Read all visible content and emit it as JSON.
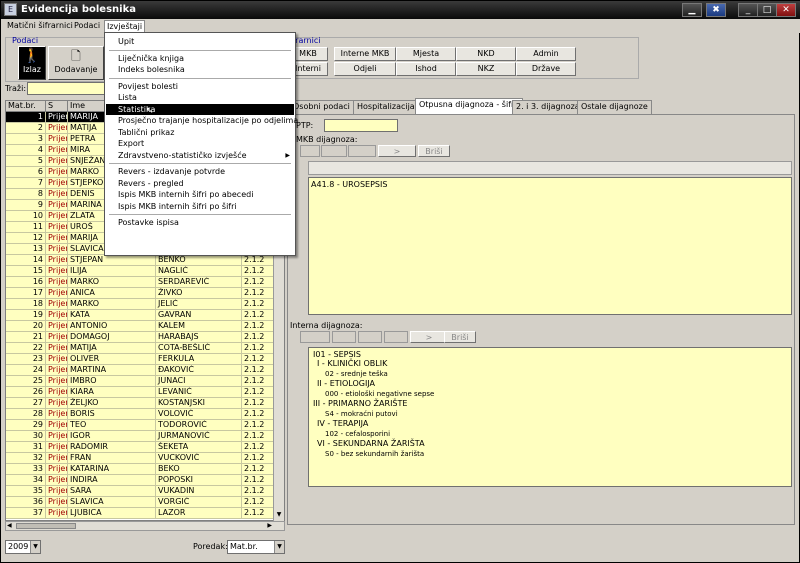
{
  "window": {
    "title": "Evidencija bolesnika",
    "icon_label": "E",
    "buttons": [
      "▁",
      "✖",
      "□",
      "✕"
    ]
  },
  "menubar": {
    "items": [
      "Matični šifrarnici",
      "Podaci",
      "Izvještaji"
    ]
  },
  "podaci_group": {
    "title": "Podaci",
    "exit_label": "Izlaz",
    "add_label": "Dodavanje"
  },
  "sifrarnici_group": {
    "title": "šifrarnici",
    "row1": [
      "MKB",
      "Interne MKB",
      "Mjesta",
      "NKD",
      "Admin"
    ],
    "row2": [
      "Interni",
      "Odjeli",
      "Ishod",
      "NKZ",
      "Države"
    ]
  },
  "search": {
    "label": "Traži:",
    "value": ""
  },
  "grid": {
    "headers": [
      "Mat.br.",
      "S",
      "Ime",
      "",
      ""
    ],
    "rows": [
      [
        "1",
        "Prijem",
        "MARIJA",
        "",
        ""
      ],
      [
        "2",
        "Prijem",
        "MATIJA",
        "",
        ""
      ],
      [
        "3",
        "Prijem",
        "PETRA",
        "",
        ""
      ],
      [
        "4",
        "Prijem",
        "MIRA",
        "",
        ""
      ],
      [
        "5",
        "Prijem",
        "SNJEŽAN",
        "",
        ""
      ],
      [
        "6",
        "Prijem",
        "MARKO",
        "",
        ""
      ],
      [
        "7",
        "Prijem",
        "STJEPKO",
        "",
        ""
      ],
      [
        "8",
        "Prijem",
        "DENIS",
        "",
        ""
      ],
      [
        "9",
        "Prijem",
        "MARINA",
        "",
        ""
      ],
      [
        "10",
        "Prijem",
        "ZLATA",
        "",
        ""
      ],
      [
        "11",
        "Prijem",
        "UROŠ",
        "",
        ""
      ],
      [
        "12",
        "Prijem",
        "MARIJA",
        "",
        ""
      ],
      [
        "13",
        "Prijem",
        "SLAVICA",
        "",
        ""
      ],
      [
        "14",
        "Prijem",
        "STJEPAN",
        "BENKO",
        "2.1.2"
      ],
      [
        "15",
        "Prijem",
        "ILIJA",
        "NAGLIĆ",
        "2.1.2"
      ],
      [
        "16",
        "Prijem",
        "MARKO",
        "SERDAREVIĆ",
        "2.1.2"
      ],
      [
        "17",
        "Prijem",
        "ANICA",
        "ŽIVKO",
        "2.1.2"
      ],
      [
        "18",
        "Prijem",
        "MARKO",
        "JELIĆ",
        "2.1.2"
      ],
      [
        "19",
        "Prijem",
        "KATA",
        "GAVRAN",
        "2.1.2"
      ],
      [
        "20",
        "Prijem",
        "ANTONIO",
        "KALEM",
        "2.1.2"
      ],
      [
        "21",
        "Prijem",
        "DOMAGOJ",
        "HARABAJS",
        "2.1.2"
      ],
      [
        "22",
        "Prijem",
        "MATIJA",
        "COTA-BEŠLIĆ",
        "2.1.2"
      ],
      [
        "23",
        "Prijem",
        "OLIVER",
        "FERKULA",
        "2.1.2"
      ],
      [
        "24",
        "Prijem",
        "MARTINA",
        "ĐAKOVIĆ",
        "2.1.2"
      ],
      [
        "25",
        "Prijem",
        "IMBRO",
        "JUNACI",
        "2.1.2"
      ],
      [
        "26",
        "Prijem",
        "KIARA",
        "LEVANIĆ",
        "2.1.2"
      ],
      [
        "27",
        "Prijem",
        "ŽELJKO",
        "KOSTANJSKI",
        "2.1.2"
      ],
      [
        "28",
        "Prijem",
        "BORIS",
        "VOLOVIĆ",
        "2.1.2"
      ],
      [
        "29",
        "Prijem",
        "TEO",
        "TODOROVIĆ",
        "2.1.2"
      ],
      [
        "30",
        "Prijem",
        "IGOR",
        "JURMANOVIĆ",
        "2.1.2"
      ],
      [
        "31",
        "Prijem",
        "RADOMIR",
        "ŠEKETA",
        "2.1.2"
      ],
      [
        "32",
        "Prijem",
        "FRAN",
        "VUCKOVIĆ",
        "2.1.2"
      ],
      [
        "33",
        "Prijem",
        "KATARINA",
        "BEKO",
        "2.1.2"
      ],
      [
        "34",
        "Prijem",
        "INDIRA",
        "POPOSKI",
        "2.1.2"
      ],
      [
        "35",
        "Prijem",
        "SARA",
        "VUKADIN",
        "2.1.2"
      ],
      [
        "36",
        "Prijem",
        "SLAVICA",
        "VORGIĆ",
        "2.1.2"
      ],
      [
        "37",
        "Prijem",
        "LJUBICA",
        "LAZOR",
        "2.1.2"
      ]
    ]
  },
  "year_combo": "2009",
  "sort": {
    "label": "Poredak:",
    "value": "Mat.br."
  },
  "tabs": [
    "Osobni podaci",
    "Hospitalizacija",
    "Otpusna dijagnoza - šifre",
    "2. i 3. dijagnoza",
    "Ostale dijagnoze"
  ],
  "discharge": {
    "ptp_label": "PTP:",
    "mkb_label": "MKB dijagnoza:",
    "nav_btn": ">",
    "del_btn": "Briši",
    "mkb_items": [
      "A41.8 - UROSEPSIS"
    ],
    "internal_label": "Interna dijagnoza:",
    "internal_items": [
      "I01 - SEPSIS",
      "I - KLINIČKI OBLIK",
      "02 - srednje teška",
      "II - ETIOLOGIJA",
      "000 - etiološki negativne sepse",
      "III - PRIMARNO ŽARIŠTE",
      "S4 - mokraćni putovi",
      "IV - TERAPIJA",
      "102 - cefalosporini",
      "VI - SEKUNDARNA ŽARIŠTA",
      "S0 - bez sekundarnih žarišta"
    ]
  },
  "dropdown": {
    "items": [
      {
        "label": "Upit"
      },
      {
        "sep": true
      },
      {
        "label": "Liječnička knjiga"
      },
      {
        "label": "Indeks bolesnika"
      },
      {
        "sep": true
      },
      {
        "label": "Povijest bolesti"
      },
      {
        "label": "Lista"
      },
      {
        "label": "Statistika",
        "highlighted": true
      },
      {
        "label": "Prosječno trajanje hospitalizacije po odjelima"
      },
      {
        "label": "Tablični prikaz"
      },
      {
        "label": "Export"
      },
      {
        "label": "Zdravstveno-statističko izvješće",
        "submenu": true
      },
      {
        "sep": true
      },
      {
        "label": "Revers - izdavanje potvrde"
      },
      {
        "label": "Revers - pregled"
      },
      {
        "label": "Ispis MKB internih šifri po abecedi"
      },
      {
        "label": "Ispis MKB internih šifri po šifri"
      },
      {
        "sep": true
      },
      {
        "label": "Postavke ispisa"
      }
    ]
  }
}
